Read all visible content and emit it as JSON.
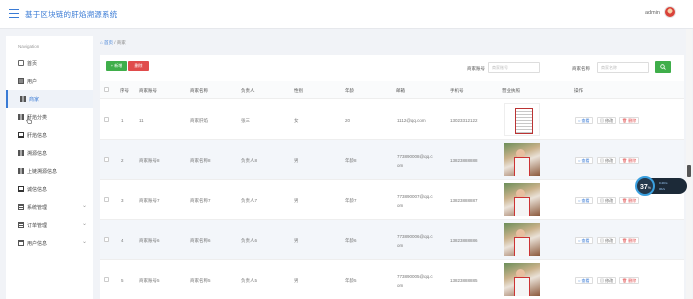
{
  "header": {
    "app_title": "基于区块链的肝焰溯源系统",
    "user_name": "admin"
  },
  "sidebar": {
    "title": "Navigation",
    "items": [
      {
        "label": "首页",
        "icon": "home-icon",
        "active": false,
        "has_children": false
      },
      {
        "label": "用户",
        "icon": "user-box-icon",
        "active": false,
        "has_children": false
      },
      {
        "label": "商家",
        "icon": "grid-icon",
        "active": true,
        "has_children": false
      },
      {
        "label": "肝焰分类",
        "icon": "grid-icon",
        "active": false,
        "has_children": false
      },
      {
        "label": "肝焰信息",
        "icon": "monitor-icon",
        "active": false,
        "has_children": false
      },
      {
        "label": "溯源信息",
        "icon": "grid-icon",
        "active": false,
        "has_children": false
      },
      {
        "label": "上链溯源信息",
        "icon": "grid-icon",
        "active": false,
        "has_children": false
      },
      {
        "label": "诚信信息",
        "icon": "monitor-icon",
        "active": false,
        "has_children": false
      },
      {
        "label": "系统管理",
        "icon": "table-icon",
        "active": false,
        "has_children": true
      },
      {
        "label": "订单管理",
        "icon": "table-icon",
        "active": false,
        "has_children": true
      },
      {
        "label": "用户信息",
        "icon": "window-icon",
        "active": false,
        "has_children": true
      }
    ]
  },
  "breadcrumb": {
    "home": "首页",
    "current": "商家"
  },
  "toolbar": {
    "add_label": "+ 新增",
    "delete_label": "删除",
    "search_account_label": "商家账号",
    "search_account_placeholder": "商家账号",
    "search_name_label": "商家名称",
    "search_name_placeholder": "商家名称"
  },
  "table": {
    "columns": [
      "序号",
      "商家账号",
      "商家名称",
      "负责人",
      "性别",
      "年龄",
      "邮箱",
      "手机号",
      "营业执照",
      "操作"
    ],
    "rows": [
      {
        "index": "1",
        "account": "11",
        "name": "商家肝焰",
        "person": "张三",
        "gender": "女",
        "age": "20",
        "email": [
          "1112@qq.com",
          ""
        ],
        "phone": "13023312122",
        "image": "certificate"
      },
      {
        "index": "2",
        "account": "商家账号8",
        "name": "商家名称8",
        "person": "负责人8",
        "gender": "男",
        "age": "年龄8",
        "email": [
          "773890008@qq.c",
          "om"
        ],
        "phone": "13823888888",
        "image": "photo"
      },
      {
        "index": "3",
        "account": "商家账号7",
        "name": "商家名称7",
        "person": "负责人7",
        "gender": "男",
        "age": "年龄7",
        "email": [
          "773890007@qq.c",
          "om"
        ],
        "phone": "13823888887",
        "image": "photo"
      },
      {
        "index": "4",
        "account": "商家账号6",
        "name": "商家名称6",
        "person": "负责人6",
        "gender": "男",
        "age": "年龄6",
        "email": [
          "773890006@qq.c",
          "om"
        ],
        "phone": "13823888886",
        "image": "photo"
      },
      {
        "index": "5",
        "account": "商家账号5",
        "name": "商家名称5",
        "person": "负责人5",
        "gender": "男",
        "age": "年龄5",
        "email": [
          "773890005@qq.c",
          "om"
        ],
        "phone": "13823888885",
        "image": "photo"
      }
    ],
    "actions": {
      "view": "查看",
      "edit": "修改",
      "delete": "删除"
    }
  },
  "widget": {
    "value": "37",
    "unit": "%",
    "line1": "0.2K/s",
    "line2": "0K/s"
  },
  "colors": {
    "accent": "#3a7bd5",
    "add": "#3fae4a",
    "delete": "#e04b4b"
  }
}
